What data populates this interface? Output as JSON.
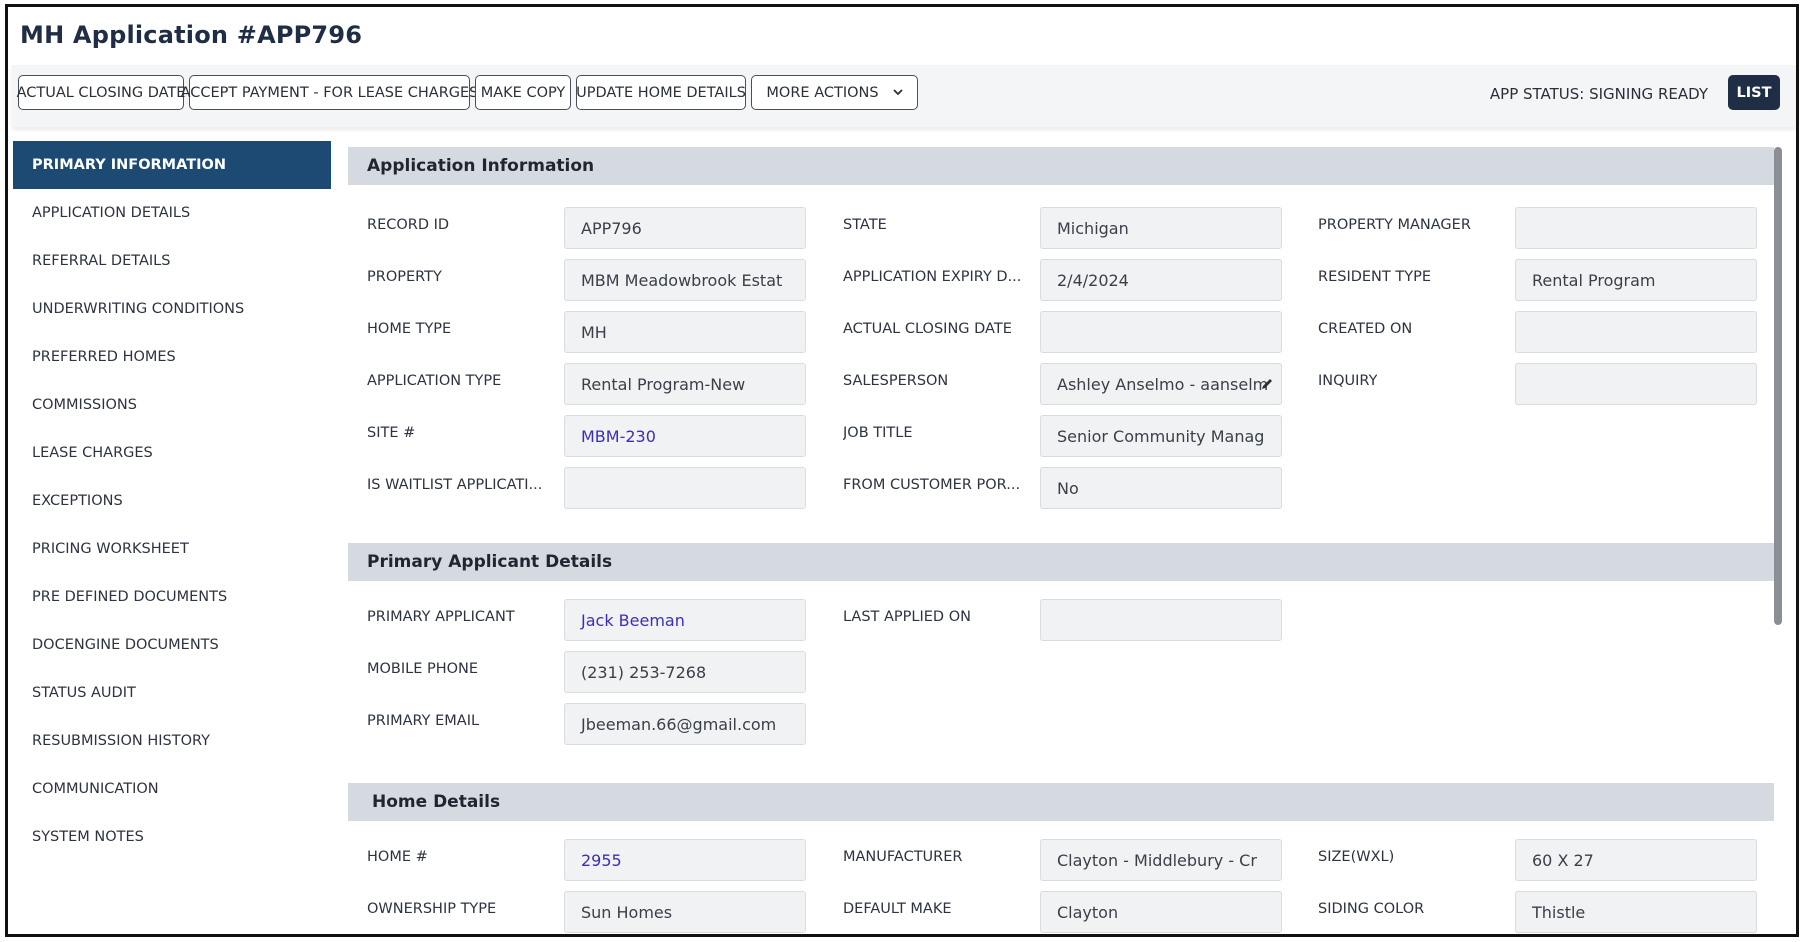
{
  "title": "MH Application #APP796",
  "toolbar": {
    "buttons": [
      "ACTUAL CLOSING DATE",
      "ACCEPT PAYMENT - FOR LEASE CHARGES",
      "MAKE COPY",
      "UPDATE HOME DETAILS",
      "MORE ACTIONS"
    ],
    "app_status": "APP STATUS: SIGNING READY",
    "list_label": "LIST"
  },
  "sidebar": {
    "items": [
      "PRIMARY INFORMATION",
      "APPLICATION DETAILS",
      "REFERRAL DETAILS",
      "UNDERWRITING CONDITIONS",
      "PREFERRED HOMES",
      "COMMISSIONS",
      "LEASE CHARGES",
      "EXCEPTIONS",
      "PRICING WORKSHEET",
      "PRE DEFINED DOCUMENTS",
      "DOCENGINE DOCUMENTS",
      "STATUS AUDIT",
      "RESUBMISSION HISTORY",
      "COMMUNICATION",
      "SYSTEM NOTES"
    ],
    "active_index": 0
  },
  "sections": {
    "application_info": {
      "header": "Application Information",
      "fields": {
        "record_id": {
          "label": "RECORD ID",
          "value": "APP796"
        },
        "property": {
          "label": "PROPERTY",
          "value": "MBM Meadowbrook Estat"
        },
        "home_type": {
          "label": "HOME TYPE",
          "value": "MH"
        },
        "application_type": {
          "label": "APPLICATION TYPE",
          "value": "Rental Program-New"
        },
        "site": {
          "label": "SITE #",
          "value": "MBM-230"
        },
        "is_waitlist": {
          "label": "IS WAITLIST APPLICATI...",
          "value": ""
        },
        "state": {
          "label": "STATE",
          "value": "Michigan"
        },
        "expiry": {
          "label": "APPLICATION EXPIRY D...",
          "value": "2/4/2024"
        },
        "actual_closing": {
          "label": "ACTUAL CLOSING DATE",
          "value": ""
        },
        "salesperson": {
          "label": "SALESPERSON",
          "value": "Ashley Anselmo - aanselm"
        },
        "job_title": {
          "label": "JOB TITLE",
          "value": "Senior Community Manag"
        },
        "from_customer_portal": {
          "label": "FROM CUSTOMER POR...",
          "value": "No"
        },
        "property_manager": {
          "label": "PROPERTY MANAGER",
          "value": ""
        },
        "resident_type": {
          "label": "RESIDENT TYPE",
          "value": "Rental Program"
        },
        "created_on": {
          "label": "CREATED ON",
          "value": ""
        },
        "inquiry": {
          "label": "INQUIRY",
          "value": ""
        }
      }
    },
    "primary_applicant": {
      "header": "Primary Applicant Details",
      "fields": {
        "primary_applicant": {
          "label": "PRIMARY APPLICANT",
          "value": "Jack Beeman"
        },
        "mobile_phone": {
          "label": "MOBILE PHONE",
          "value": "(231) 253-7268"
        },
        "primary_email": {
          "label": "PRIMARY EMAIL",
          "value": "Jbeeman.66@gmail.com"
        },
        "last_applied_on": {
          "label": "LAST APPLIED ON",
          "value": ""
        }
      }
    },
    "home_details": {
      "header": "Home Details",
      "fields": {
        "home_no": {
          "label": "HOME #",
          "value": "2955"
        },
        "ownership_type": {
          "label": "OWNERSHIP TYPE",
          "value": "Sun Homes"
        },
        "manufacturer": {
          "label": "MANUFACTURER",
          "value": "Clayton - Middlebury - Cr"
        },
        "default_make": {
          "label": "DEFAULT MAKE",
          "value": "Clayton"
        },
        "size": {
          "label": "SIZE(WXL)",
          "value": "60 X 27"
        },
        "siding_color": {
          "label": "SIDING COLOR",
          "value": "Thistle"
        }
      }
    }
  },
  "colors": {
    "title": "#1f2d45",
    "active_nav": "#1d4a72",
    "section_header": "#d5dae1",
    "link_value": "#3a2fb8",
    "list_button": "#1f2d45"
  },
  "icons": {
    "more_actions": "chevron-down-icon",
    "salesperson": "pencil-edit-icon"
  }
}
